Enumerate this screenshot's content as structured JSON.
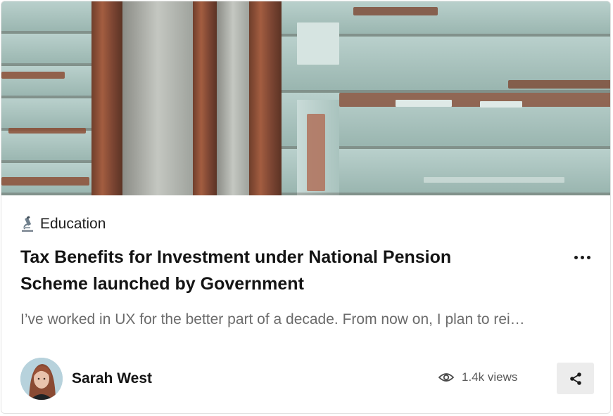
{
  "card": {
    "cover_image_alt": "peeling painted wooden wall",
    "category": {
      "icon": "microscope-icon",
      "label": "Education"
    },
    "title": "Tax Benefits for Investment under National Pension Scheme launched by Government",
    "excerpt": "I’ve worked in UX for the better part of a decade. From now on, I plan to rei…",
    "author": {
      "name": "Sarah West",
      "avatar": "avatar-photo"
    },
    "views": {
      "icon": "eye-icon",
      "label": "1.4k views"
    },
    "actions": {
      "more": "more-options-icon",
      "share": "share-icon"
    }
  }
}
